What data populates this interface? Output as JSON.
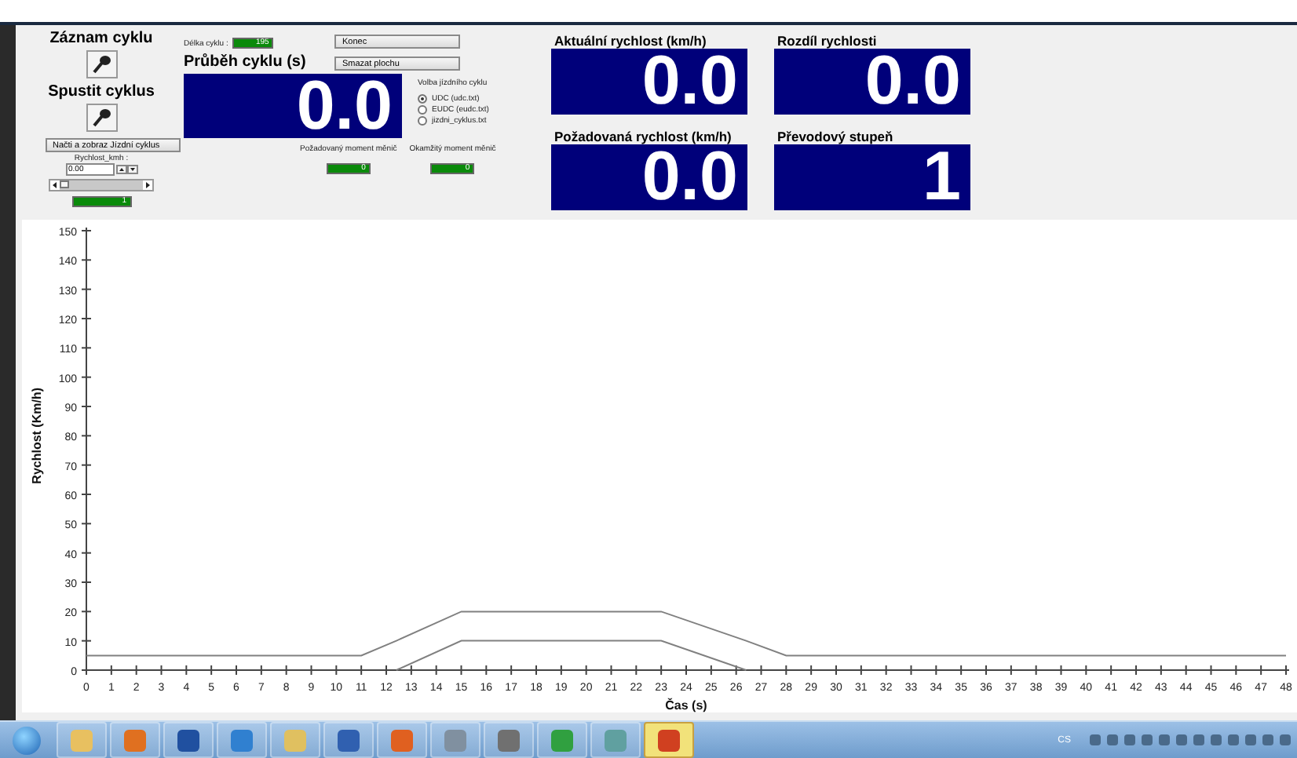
{
  "record": {
    "title": "Záznam cyklu"
  },
  "start": {
    "title": "Spustit cyklus"
  },
  "load_button": "Načti a zobraz Jízdní cyklus",
  "speed_spinner": {
    "label": "Rychlost_kmh :",
    "value": "0.00"
  },
  "small_display": "1",
  "cycle_length": {
    "label": "Délka cyklu :",
    "value": "195"
  },
  "buttons": [
    "Konec",
    "Smazat plochu"
  ],
  "cycle_progress": {
    "title": "Průběh cyklu (s)",
    "value": "0.0"
  },
  "cycle_choice": {
    "title": "Volba jízdního cyklu",
    "options": [
      {
        "label": "UDC (udc.txt)",
        "selected": true
      },
      {
        "label": "EUDC (eudc.txt)",
        "selected": false
      },
      {
        "label": "jizdni_cyklus.txt",
        "selected": false
      }
    ]
  },
  "moments": [
    {
      "label": "Požadovaný moment měnič",
      "value": "0"
    },
    {
      "label": "Okamžitý moment měnič",
      "value": "0"
    }
  ],
  "displays": [
    {
      "title": "Aktuální rychlost (km/h)",
      "value": "0.0"
    },
    {
      "title": "Rozdíl rychlosti",
      "value": "0.0"
    },
    {
      "title": "Požadovaná rychlost (km/h)",
      "value": "0.0"
    },
    {
      "title": "Převodový stupeň",
      "value": "1"
    }
  ],
  "chart": {
    "chart_data": {
      "type": "line",
      "xlabel": "Čas (s)",
      "ylabel": "Rychlost (Km/h)",
      "x": [
        0,
        11,
        12.4,
        15,
        23,
        26.4,
        28,
        48
      ],
      "series": [
        {
          "color": "#808080",
          "values": [
            5,
            5,
            10,
            20,
            20,
            10,
            5,
            5
          ]
        },
        {
          "color": "#808080",
          "values": [
            null,
            null,
            0,
            10,
            10,
            0,
            null,
            null
          ]
        }
      ],
      "xlim": [
        0,
        48
      ],
      "ylim": [
        0,
        150
      ],
      "xticks": [
        0,
        1,
        2,
        3,
        4,
        5,
        6,
        7,
        8,
        9,
        10,
        11,
        12,
        13,
        14,
        15,
        16,
        17,
        18,
        19,
        20,
        21,
        22,
        23,
        24,
        25,
        26,
        27,
        28,
        29,
        30,
        31,
        32,
        33,
        34,
        35,
        36,
        37,
        38,
        39,
        40,
        41,
        42,
        43,
        44,
        45,
        46,
        47,
        48
      ],
      "yticks": [
        0,
        10,
        20,
        30,
        40,
        50,
        60,
        70,
        80,
        90,
        100,
        110,
        120,
        130,
        140,
        150
      ]
    }
  },
  "taskbar": {
    "apps": [
      {
        "selected": false
      },
      {
        "selected": false
      },
      {
        "selected": false
      },
      {
        "selected": false
      },
      {
        "selected": false
      },
      {
        "selected": false
      },
      {
        "selected": false
      },
      {
        "selected": false
      },
      {
        "selected": false
      },
      {
        "selected": false
      },
      {
        "selected": false
      },
      {
        "selected": true
      }
    ],
    "language": "CS"
  }
}
